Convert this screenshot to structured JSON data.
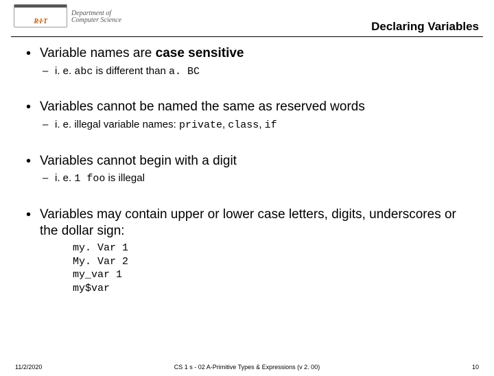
{
  "header": {
    "logo_text": "R·I·T",
    "dept_line1": "Department of",
    "dept_line2": "Computer Science",
    "title": "Declaring Variables"
  },
  "bullets": [
    {
      "lead": "Variable names are ",
      "bold": "case sensitive",
      "sub": {
        "pre": "i. e.  ",
        "code1": "abc",
        "mid": " is different than ",
        "code2": "a. BC"
      }
    },
    {
      "lead": "Variables cannot be named the same as reserved words",
      "sub": {
        "pre": "i. e. illegal variable names: ",
        "code1": "private",
        "mid": ", ",
        "code2": "class",
        "mid2": ", ",
        "code3": "if"
      }
    },
    {
      "lead": "Variables cannot begin with a digit",
      "sub": {
        "pre": "i. e. ",
        "code1": "1 foo",
        "mid": " is illegal"
      }
    },
    {
      "lead": "Variables may contain upper or lower case letters, digits, underscores or the dollar sign:",
      "examples": [
        "my. Var 1",
        "My. Var 2",
        "my_var 1",
        "my$var"
      ]
    }
  ],
  "footer": {
    "date": "11/2/2020",
    "center": "CS 1 s - 02 A-Primitive Types & Expressions (v 2. 00)",
    "page": "10"
  }
}
